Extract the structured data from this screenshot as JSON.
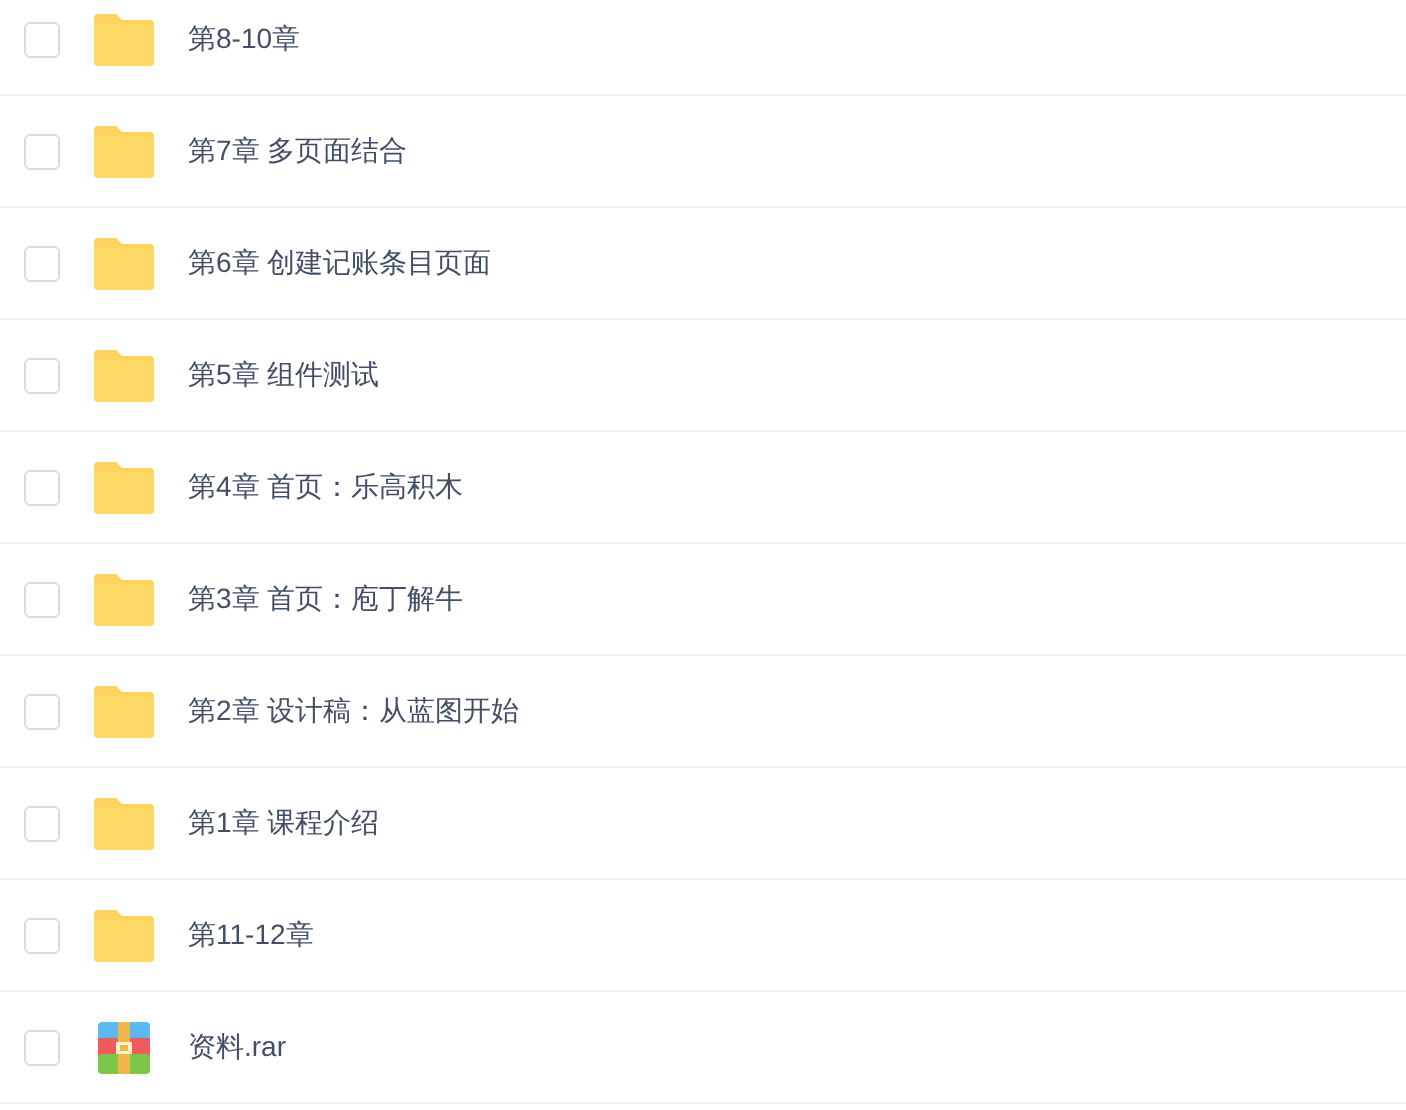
{
  "files": [
    {
      "kind": "folder",
      "name": "第8-10章",
      "checked": false
    },
    {
      "kind": "folder",
      "name": "第7章 多页面结合",
      "checked": false
    },
    {
      "kind": "folder",
      "name": "第6章 创建记账条目页面",
      "checked": false
    },
    {
      "kind": "folder",
      "name": "第5章 组件测试",
      "checked": false
    },
    {
      "kind": "folder",
      "name": "第4章 首页：乐高积木",
      "checked": false
    },
    {
      "kind": "folder",
      "name": "第3章 首页：庖丁解牛",
      "checked": false
    },
    {
      "kind": "folder",
      "name": "第2章 设计稿：从蓝图开始",
      "checked": false
    },
    {
      "kind": "folder",
      "name": "第1章 课程介绍",
      "checked": false
    },
    {
      "kind": "folder",
      "name": "第11-12章",
      "checked": false
    },
    {
      "kind": "archive",
      "name": "资料.rar",
      "checked": false
    }
  ]
}
